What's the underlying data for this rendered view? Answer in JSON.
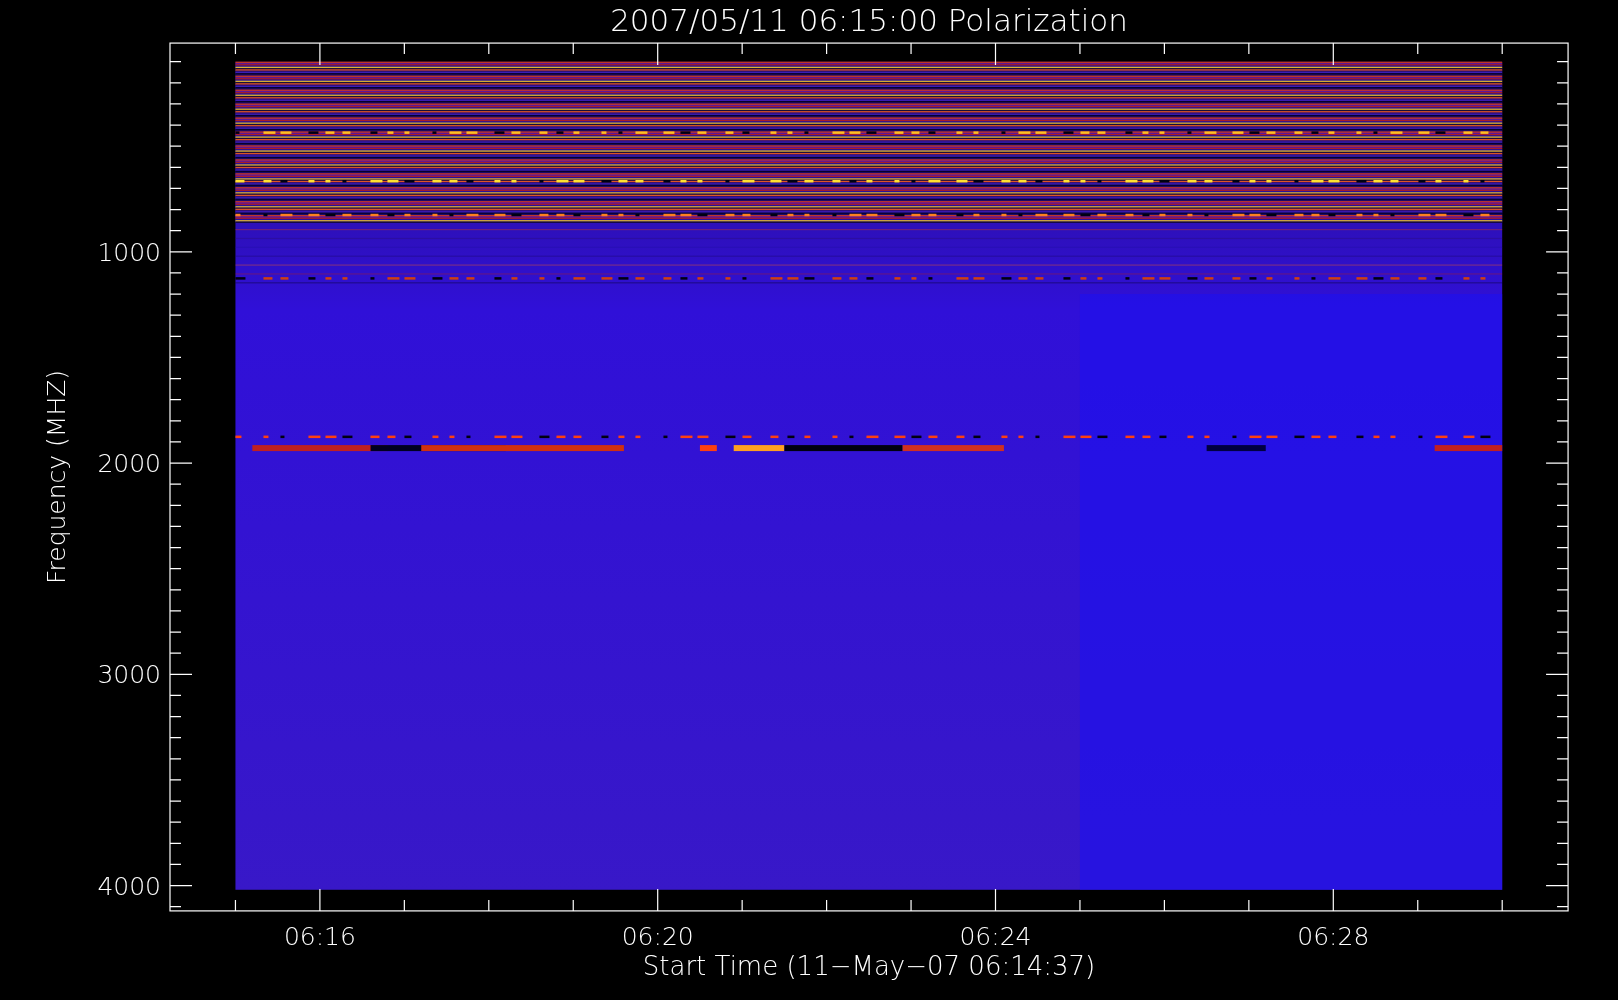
{
  "title": "2007/05/11 06:15:00 Polarization",
  "y_axis": {
    "label": "Frequency (MHZ)",
    "ticks": [
      "1000",
      "2000",
      "3000",
      "4000"
    ]
  },
  "x_axis": {
    "label": "Start Time (11−May−07 06:14:37)",
    "ticks": [
      "06:16",
      "06:20",
      "06:24",
      "06:28"
    ]
  }
}
